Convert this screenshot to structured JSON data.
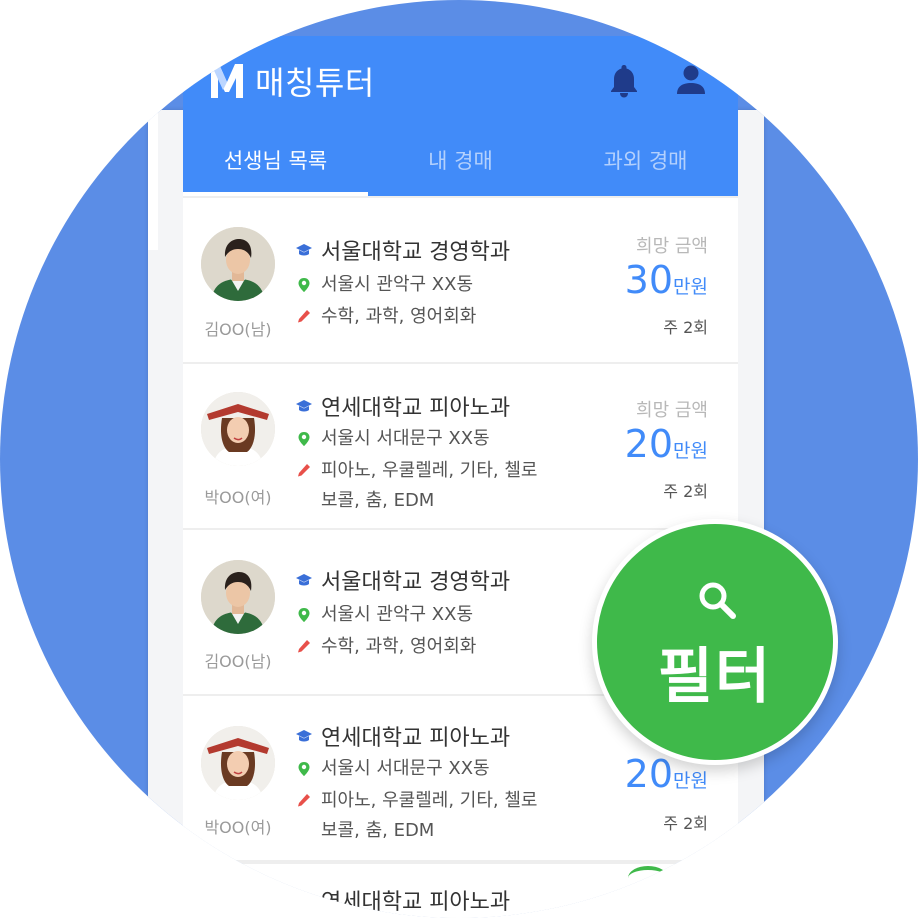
{
  "app": {
    "title": "매칭튜터",
    "logo_letter": "M"
  },
  "tabs": [
    {
      "label": "선생님 목록",
      "active": true
    },
    {
      "label": "내 경매",
      "active": false
    },
    {
      "label": "과외 경매",
      "active": false
    }
  ],
  "cards": [
    {
      "name": "김OO(남)",
      "school": "서울대학교 경영학과",
      "location": "서울시 관악구 XX동",
      "subjects": "수학, 과학, 영어회화",
      "subjects2": "",
      "price_label": "희망 금액",
      "price": "30",
      "unit": "만원",
      "freq": "주 2회"
    },
    {
      "name": "박OO(여)",
      "school": "연세대학교 피아노과",
      "location": "서울시 서대문구 XX동",
      "subjects": "피아노, 우쿨렐레, 기타, 첼로",
      "subjects2": "보콜, 춤, EDM",
      "price_label": "희망 금액",
      "price": "20",
      "unit": "만원",
      "freq": "주 2회"
    },
    {
      "name": "김OO(남)",
      "school": "서울대학교 경영학과",
      "location": "서울시 관악구 XX동",
      "subjects": "수학, 과학, 영어회화",
      "subjects2": ""
    },
    {
      "name": "박OO(여)",
      "school": "연세대학교 피아노과",
      "location": "서울시 서대문구 XX동",
      "subjects": "피아노, 우쿨렐레, 기타, 첼로",
      "subjects2": "보콜, 춤, EDM",
      "price": "20",
      "unit": "만원",
      "freq": "주 2회"
    },
    {
      "school": "연세대학교 피아노과"
    }
  ],
  "fab": {
    "label": "필터"
  },
  "colors": {
    "primary": "#418bf9",
    "fab": "#3fb94a",
    "background_circle": "#5b8de6"
  },
  "icons": [
    "logo-icon",
    "bell-icon",
    "user-icon",
    "graduation-cap-icon",
    "location-pin-icon",
    "pencil-icon",
    "search-icon"
  ]
}
